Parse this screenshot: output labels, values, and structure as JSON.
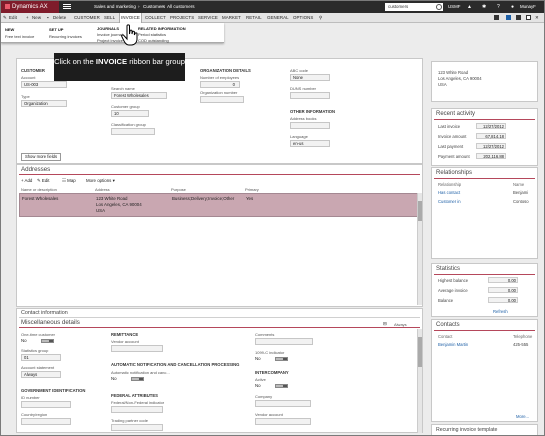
{
  "app": {
    "brand": "Dynamics AX",
    "breadcrumbs": [
      "Sales and marketing",
      "Customers",
      "All customers"
    ]
  },
  "top": {
    "search_value": "customers",
    "company": "USMF",
    "user": "MunayF",
    "icons": [
      "bell-icon",
      "gear-icon",
      "help-icon"
    ]
  },
  "actions": {
    "items": [
      "Edit",
      "New",
      "Delete",
      "CUSTOMER",
      "SELL",
      "INVOICE",
      "COLLECT",
      "PROJECTS",
      "SERVICE",
      "MARKET",
      "RETAIL",
      "GENERAL",
      "OPTIONS"
    ]
  },
  "ribbon": {
    "groups": [
      {
        "header": "NEW",
        "items": [
          "Free text invoice"
        ]
      },
      {
        "header": "SET UP",
        "items": [
          "Recurring invoices"
        ]
      },
      {
        "header": "JOURNALS",
        "items": [
          "Invoice journal",
          "Project invoice"
        ]
      },
      {
        "header": "RELATED INFORMATION",
        "items": [
          "Period statistics",
          "COD outstanding"
        ]
      }
    ]
  },
  "callout": {
    "pre": "Click on the ",
    "strong": "INVOICE",
    "post": " ribbon bar group"
  },
  "customer": {
    "section_customer": "CUSTOMER",
    "account_label": "Account",
    "account_value": "US-003",
    "type_label": "Type",
    "type_value": "Organization",
    "search_name_label": "Search name",
    "search_name_value": "Forest Wholesales",
    "customer_group_label": "Customer group",
    "customer_group_value": "10",
    "classification_label": "Classification group",
    "classification_value": "",
    "section_org": "ORGANIZATION DETAILS",
    "employees_label": "Number of employees",
    "employees_value": "0",
    "orgnum_label": "Organization number",
    "orgnum_value": "",
    "abc_label": "ABC code",
    "abc_value": "None",
    "duns_label": "DUNS number",
    "duns_value": "",
    "section_other": "OTHER INFORMATION",
    "address_books_label": "Address books",
    "address_books_value": "",
    "language_label": "Language",
    "language_value": "en-us",
    "show_more": "Show more fields"
  },
  "addresses": {
    "title": "Addresses",
    "toolbar": [
      "Add",
      "Edit",
      "Map",
      "More options"
    ],
    "columns": [
      "Name or description",
      "Address",
      "Purpose",
      "Primary"
    ],
    "rows": [
      {
        "name": "Forest Wholesales",
        "address_line1": "123 White Road",
        "address_line2": "Los Angeles, CA 90004",
        "address_line3": "USA",
        "purpose": "Business;Delivery;Invoice;Other",
        "primary": "Yes"
      }
    ]
  },
  "contact": {
    "title": "Contact information"
  },
  "misc": {
    "title": "Miscellaneous details",
    "always": "Always",
    "onetime_label": "One-time customer",
    "onetime_value": "No",
    "stat_group_label": "Statistics group",
    "stat_group_value": "01",
    "acct_stmt_label": "Account statement",
    "acct_stmt_value": "Always",
    "section_gov": "GOVERNMENT IDENTIFICATION",
    "id_number_label": "ID number",
    "id_number_value": "",
    "country_label": "Country/region",
    "country_value": "",
    "section_remit": "REMITTANCE",
    "vendor_acct_label": "Vendor account",
    "vendor_acct_value": "",
    "section_notif": "AUTOMATIC NOTIFICATION AND CANCELLATION PROCESSING",
    "auto_notif_label": "Automatic notification and canc...",
    "auto_notif_value": "No",
    "section_fed": "FEDERAL ATTRIBUTES",
    "federal_label": "Federal/Non-Federal indicator",
    "federal_value": "",
    "trading_label": "Trading partner code",
    "trading_value": "",
    "comments_label": "Comments",
    "comments_value": "",
    "ind1099_label": "1099-C indicator",
    "ind1099_value": "No",
    "section_interco": "INTERCOMPANY",
    "active_label": "Active",
    "active_value": "No",
    "company_label": "Company",
    "company_value": "",
    "vendor_acct2_label": "Vendor account",
    "vendor_acct2_value": ""
  },
  "factbox": {
    "address_lines": [
      "123 White Road",
      "Los Angeles, CA 90004",
      "USA"
    ],
    "recent": {
      "title": "Recent activity",
      "rows": [
        {
          "label": "Last invoice",
          "value": "12/27/2012"
        },
        {
          "label": "Invoice amount",
          "value": "67,814.18"
        },
        {
          "label": "Last payment",
          "value": "12/27/2012"
        },
        {
          "label": "Payment amount",
          "value": "202,116.88"
        }
      ]
    },
    "relationships": {
      "title": "Relationships",
      "columns": [
        "Relationship",
        "Name"
      ],
      "rows": [
        {
          "relationship": "Has contact",
          "name": "Benjami"
        },
        {
          "relationship": "Customer in",
          "name": "Contoso"
        }
      ]
    },
    "statistics": {
      "title": "Statistics",
      "rows": [
        {
          "label": "Highest balance",
          "value": "0.00"
        },
        {
          "label": "Average invoice",
          "value": "0.00"
        },
        {
          "label": "Balance",
          "value": "0.00"
        }
      ],
      "refresh": "Refresh"
    },
    "contacts": {
      "title": "Contacts",
      "columns": [
        "Contact",
        "Telephone"
      ],
      "rows": [
        {
          "contact": "Benjamin Martin",
          "phone": "425-555"
        }
      ],
      "more": "More..."
    },
    "recurring": {
      "title": "Recurring invoice template"
    }
  }
}
